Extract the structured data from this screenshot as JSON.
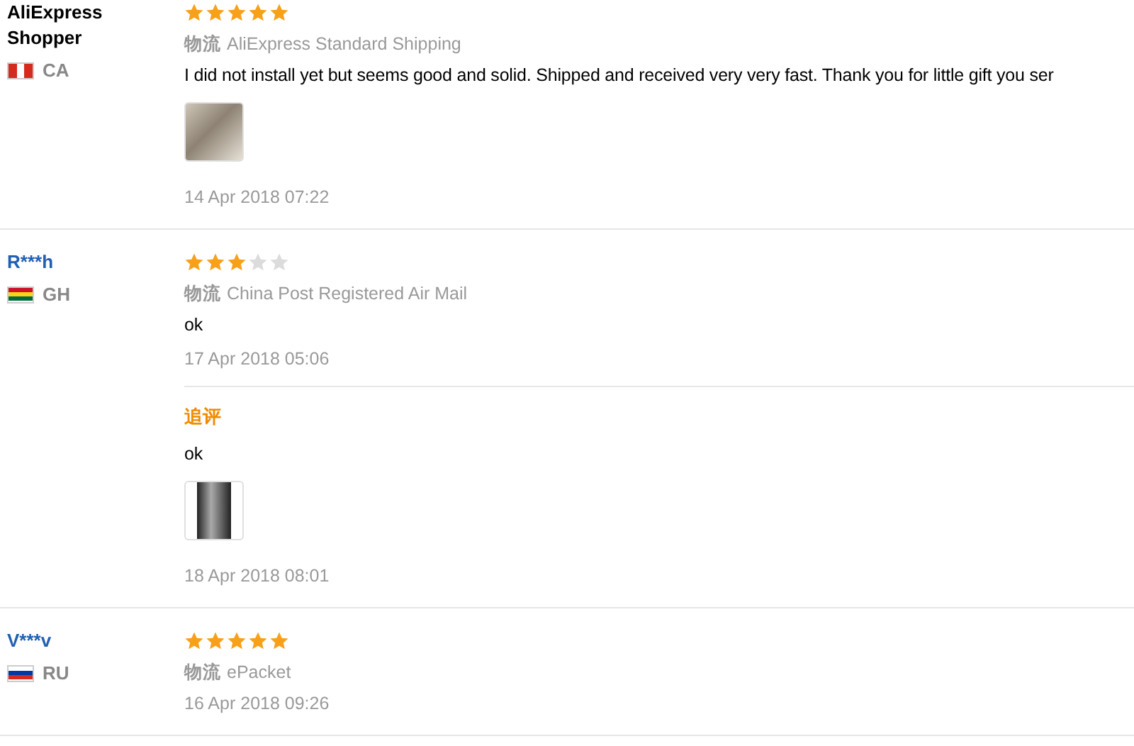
{
  "reviews": [
    {
      "name": "AliExpress Shopper",
      "name_link": false,
      "country": "CA",
      "stars": 5,
      "shipping_label": "物流",
      "shipping": "AliExpress Standard Shipping",
      "text": "I did not install yet but seems good and solid. Shipped and received very very fast. Thank you for little gift you ser",
      "photos": [
        {
          "kind": "light"
        }
      ],
      "date": "14 Apr 2018 07:22"
    },
    {
      "name": "R***h",
      "name_link": true,
      "country": "GH",
      "stars": 3,
      "shipping_label": "物流",
      "shipping": "China Post Registered Air Mail",
      "text": "ok",
      "date": "17 Apr 2018 05:06",
      "followup": {
        "label": "追评",
        "text": "ok",
        "photos": [
          {
            "kind": "dark"
          }
        ],
        "date": "18 Apr 2018 08:01"
      }
    },
    {
      "name": "V***v",
      "name_link": true,
      "country": "RU",
      "stars": 5,
      "shipping_label": "物流",
      "shipping": "ePacket",
      "date": "16 Apr 2018 09:26"
    }
  ]
}
